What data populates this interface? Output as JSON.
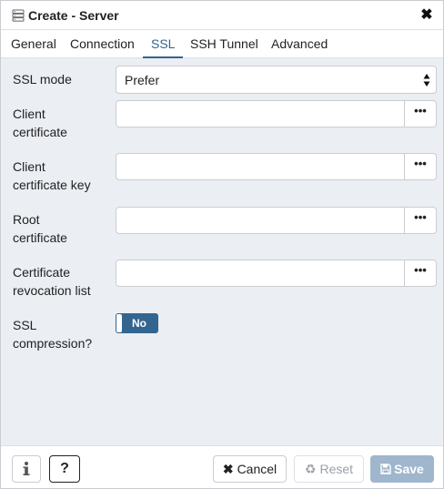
{
  "dialog": {
    "title": "Create - Server",
    "title_icon": "server-icon",
    "close_icon": "close-icon"
  },
  "tabs": [
    {
      "label": "General",
      "active": false
    },
    {
      "label": "Connection",
      "active": false
    },
    {
      "label": "SSL",
      "active": true
    },
    {
      "label": "SSH Tunnel",
      "active": false
    },
    {
      "label": "Advanced",
      "active": false
    }
  ],
  "ssl": {
    "ssl_mode": {
      "label": "SSL mode",
      "value": "Prefer"
    },
    "fields": [
      {
        "label_line1": "Client",
        "label_line2": "certificate",
        "value": "",
        "browse": "•••"
      },
      {
        "label_line1": "Client",
        "label_line2": "certificate key",
        "value": "",
        "browse": "•••"
      },
      {
        "label_line1": "Root",
        "label_line2": "certificate",
        "value": "",
        "browse": "•••"
      },
      {
        "label_line1": "Certificate",
        "label_line2": "revocation list",
        "value": "",
        "browse": "•••"
      }
    ],
    "compression": {
      "label_line1": "SSL",
      "label_line2": "compression?",
      "toggle_label": "No",
      "on": false
    }
  },
  "footer": {
    "info_icon": "info-icon",
    "help_label": "?",
    "cancel": {
      "icon": "close-icon",
      "label": "Cancel"
    },
    "reset": {
      "icon": "recycle-icon",
      "label": "Reset"
    },
    "save": {
      "icon": "floppy-disk-icon",
      "label": "Save"
    }
  },
  "colors": {
    "accent": "#326690",
    "body_bg": "#ebeef3",
    "save_disabled": "#9fb6cc"
  }
}
